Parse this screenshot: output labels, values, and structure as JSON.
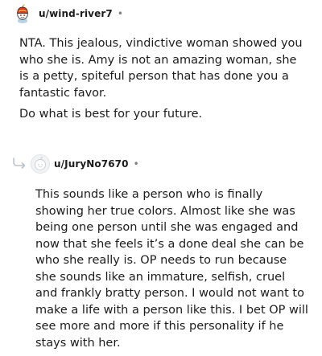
{
  "comment_1": {
    "username": "u/wind-river7",
    "separator": "•",
    "avatar": "snoo-avatar-red-cap",
    "paragraphs": [
      "NTA. This jealous, vindictive woman showed you who she is. Amy is not an amazing woman, she is a petty, spiteful person that has done you a fantastic favor.",
      "Do what is best for your future."
    ]
  },
  "comment_2": {
    "username": "u/JuryNo7670",
    "separator": "•",
    "avatar": "default-avatar-grey",
    "reply_icon": "reply-arrow-icon",
    "paragraphs": [
      "This sounds like a person who is finally showing her true colors. Almost like she was being one person until she was engaged and now that she feels it’s a done deal she can be who she really is. OP needs to run because she sounds like an immature, selfish, cruel and frankly bratty person. I would not want to make a life with a person like this. I bet OP will see more and more if this personality if he stays with her."
    ]
  },
  "colors": {
    "text": "#1c1c1c",
    "meta": "#7c7c7c",
    "reply_arrow": "#b8c4cc"
  }
}
